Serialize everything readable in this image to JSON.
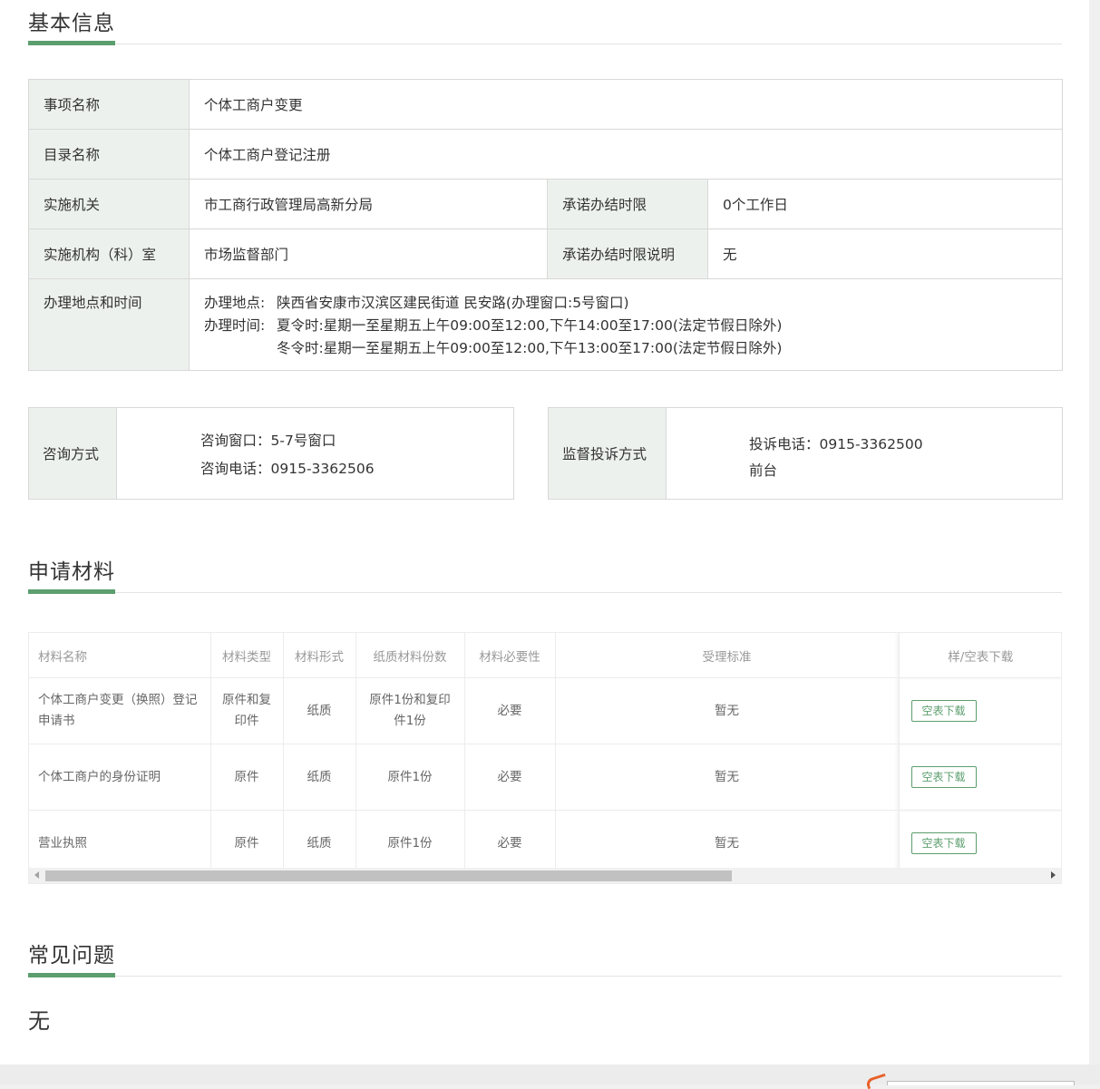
{
  "sections": {
    "basic_info": "基本信息",
    "materials": "申请材料",
    "faq": "常见问题"
  },
  "basic": {
    "item_name_label": "事项名称",
    "item_name": "个体工商户变更",
    "catalog_label": "目录名称",
    "catalog": "个体工商户登记注册",
    "agency_label": "实施机关",
    "agency": "市工商行政管理局高新分局",
    "deadline_label": "承诺办结时限",
    "deadline": "0个工作日",
    "dept_label": "实施机构（科）室",
    "dept": "市场监督部门",
    "deadline_note_label": "承诺办结时限说明",
    "deadline_note": "无",
    "location_label": "办理地点和时间",
    "address_key": "办理地点:",
    "address": "陕西省安康市汉滨区建民街道 民安路(办理窗口:5号窗口)",
    "hours_key": "办理时间:",
    "hours_summer": "夏令时:星期一至星期五上午09:00至12:00,下午14:00至17:00(法定节假日除外)",
    "hours_winter": "冬令时:星期一至星期五上午09:00至12:00,下午13:00至17:00(法定节假日除外)"
  },
  "consult": {
    "label": "咨询方式",
    "window": "咨询窗口：5-7号窗口",
    "phone": "咨询电话：0915-3362506"
  },
  "complaint": {
    "label": "监督投诉方式",
    "phone": "投诉电话：0915-3362500",
    "place": "前台"
  },
  "materials": {
    "headers": [
      "材料名称",
      "材料类型",
      "材料形式",
      "纸质材料份数",
      "材料必要性",
      "受理标准",
      "样/空表下载"
    ],
    "rows": [
      {
        "name": "个体工商户变更（换照）登记申请书",
        "type": "原件和复印件",
        "form": "纸质",
        "copies": "原件1份和复印件1份",
        "necessity": "必要",
        "standard": "暂无",
        "download": "空表下载"
      },
      {
        "name": "个体工商户的身份证明",
        "type": "原件",
        "form": "纸质",
        "copies": "原件1份",
        "necessity": "必要",
        "standard": "暂无",
        "download": "空表下载"
      },
      {
        "name": "营业执照",
        "type": "原件",
        "form": "纸质",
        "copies": "原件1份",
        "necessity": "必要",
        "standard": "暂无",
        "download": "空表下载"
      }
    ]
  },
  "faq": {
    "value": "无"
  },
  "colors": {
    "accent": "#5c9e6e",
    "label_bg": "#edf1ee",
    "border": "#d8d8d8"
  }
}
